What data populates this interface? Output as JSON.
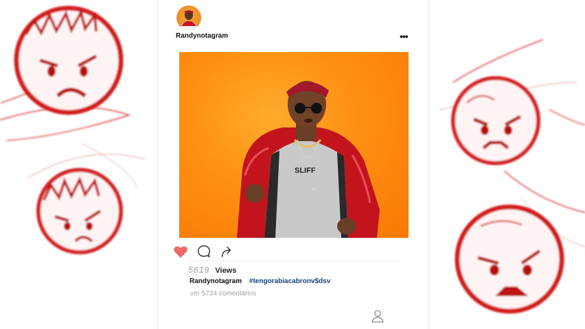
{
  "post": {
    "username": "Randynotagram",
    "more_label": "•••",
    "views_count": "5619",
    "views_label": "Views",
    "caption_user": "Randynotagram",
    "caption_tag": "#tengorabiacabronv$dsv",
    "comments_label": "ver 5734 comentarios",
    "liked": true
  },
  "icons": {
    "like": "heart-icon",
    "comment": "comment-bubble-icon",
    "share": "share-arrow-icon",
    "profile": "profile-person-icon",
    "more": "more-dots-icon"
  },
  "colors": {
    "like_active": "#f06a6a",
    "photo_background": "#ff8f12",
    "hashtag": "#1b3f7a",
    "doodle_red": "#d81e1e"
  }
}
